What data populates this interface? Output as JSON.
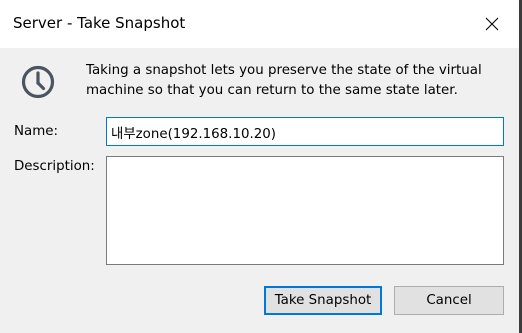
{
  "window": {
    "title": "Server - Take Snapshot"
  },
  "info": {
    "icon": "clock-icon",
    "text": "Taking a snapshot lets you preserve the state of the virtual machine so that you can return to the same state later."
  },
  "form": {
    "name_label": "Name:",
    "name_value": "내부zone(192.168.10.20)",
    "description_label": "Description:",
    "description_value": ""
  },
  "buttons": {
    "take_snapshot": "Take Snapshot",
    "cancel": "Cancel"
  },
  "colors": {
    "accent": "#0078d7",
    "icon": "#4a5561"
  }
}
